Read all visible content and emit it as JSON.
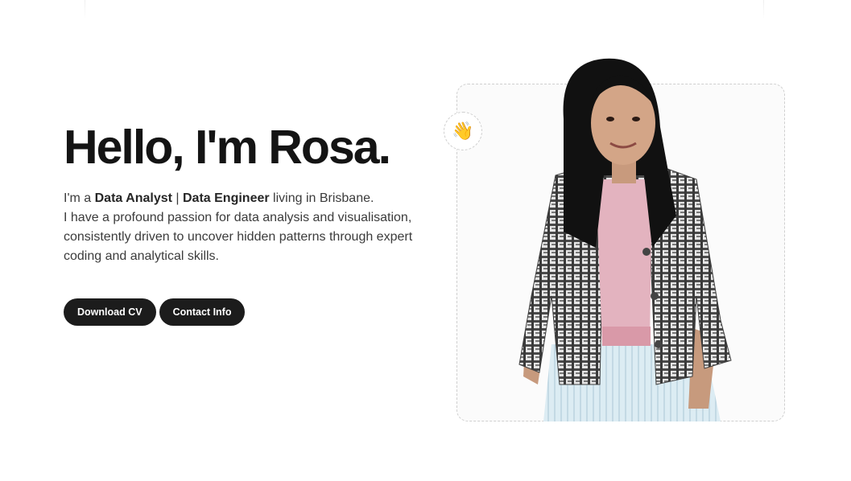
{
  "hero": {
    "title": "Hello, I'm Rosa.",
    "bio": {
      "intro_prefix": "I'm a ",
      "role_1": "Data Analyst",
      "separator": " | ",
      "role_2": "Data Engineer",
      "intro_suffix": " living in Brisbane.",
      "line_2": "I have a profound passion for data analysis and visualisation,",
      "line_3": "consistently driven to uncover hidden patterns through expert",
      "line_4": "coding and analytical skills."
    }
  },
  "actions": {
    "download_cv_label": "Download CV",
    "contact_info_label": "Contact Info"
  },
  "badge": {
    "emoji": "👋",
    "icon": "waving-hand-icon"
  },
  "colors": {
    "button_bg": "#1c1c1c",
    "button_text": "#ffffff",
    "frame_border": "#cfcfcf"
  }
}
